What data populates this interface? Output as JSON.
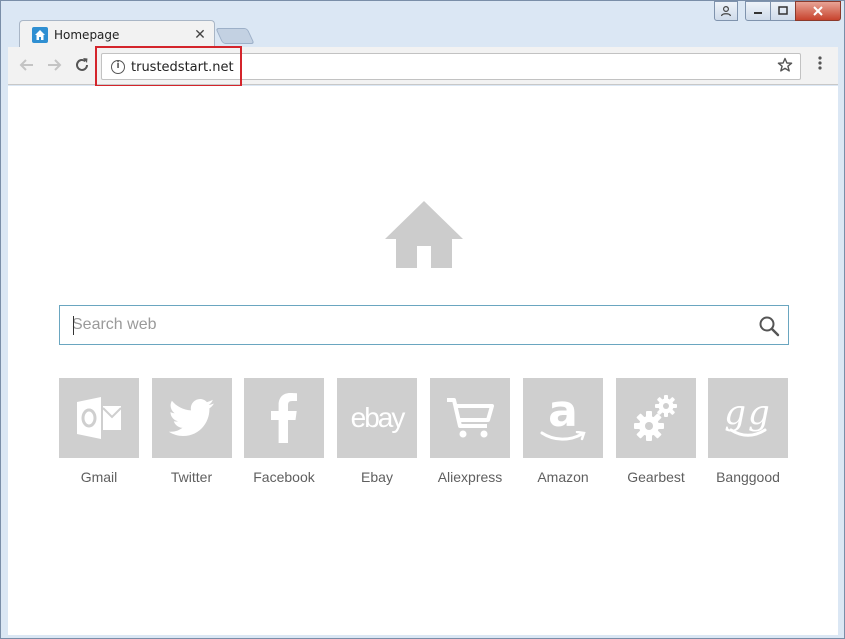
{
  "browser": {
    "tab": {
      "title": "Homepage",
      "close_glyph": "✕"
    },
    "address_bar": {
      "url": "trustedstart.net"
    },
    "colors": {
      "favicon": "#2f8fd2",
      "highlight_box": "#d4242b"
    }
  },
  "page": {
    "search": {
      "placeholder": "Search web"
    },
    "shortcuts": [
      {
        "label": "Gmail",
        "icon": "outlook-icon"
      },
      {
        "label": "Twitter",
        "icon": "twitter-bird-icon"
      },
      {
        "label": "Facebook",
        "icon": "facebook-f-icon"
      },
      {
        "label": "Ebay",
        "icon": "ebay-wordmark-icon",
        "glyph": "ebay"
      },
      {
        "label": "Aliexpress",
        "icon": "shopping-cart-icon"
      },
      {
        "label": "Amazon",
        "icon": "amazon-a-icon",
        "glyph": "a"
      },
      {
        "label": "Gearbest",
        "icon": "gears-icon"
      },
      {
        "label": "Banggood",
        "icon": "banggood-gg-icon",
        "glyph": "gg"
      }
    ]
  }
}
